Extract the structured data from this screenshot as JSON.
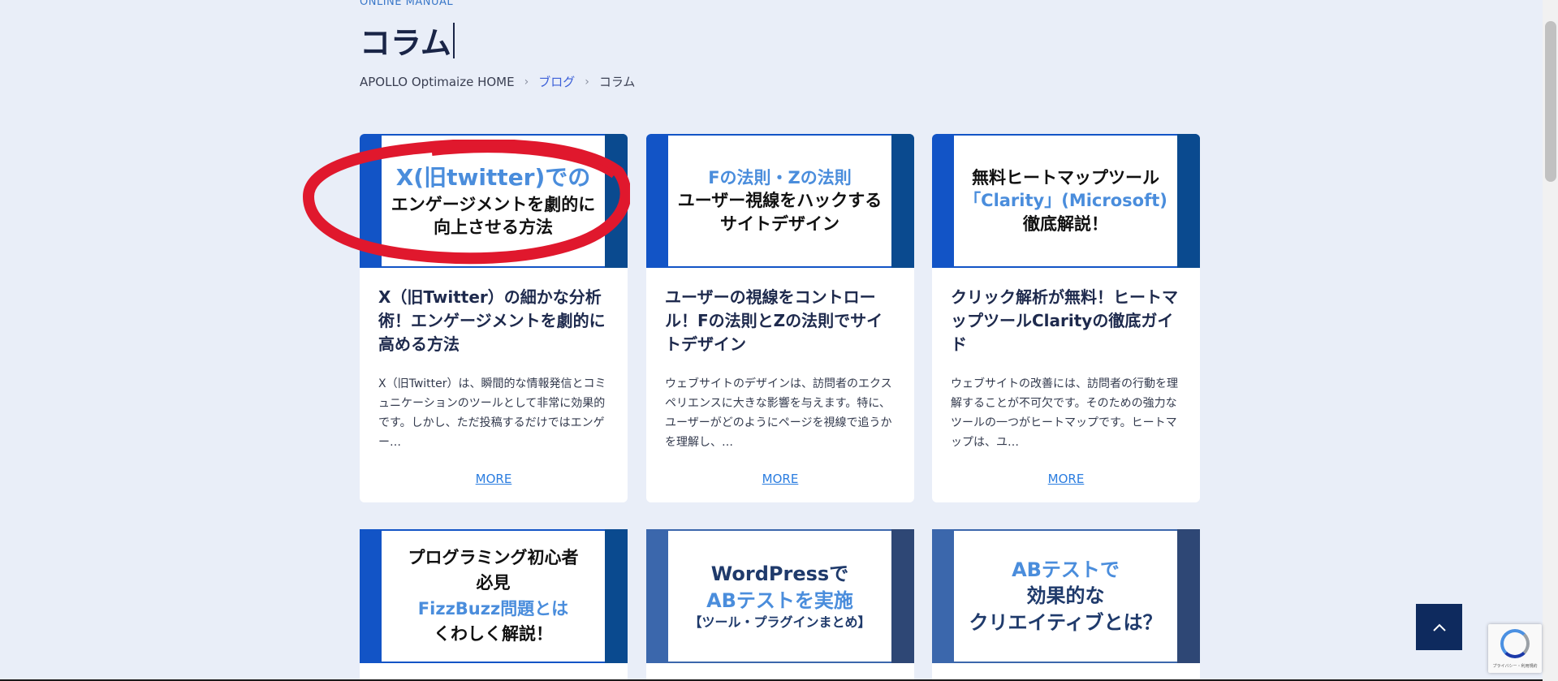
{
  "header": {
    "eyebrow": "ONLINE MANUAL",
    "title": "コラム"
  },
  "breadcrumb": {
    "home": "APOLLO Optimaize HOME",
    "blog": "ブログ",
    "current": "コラム",
    "separator": "›"
  },
  "cards": [
    {
      "thumb_lines": [
        "X(旧twitter)での",
        "エンゲージメントを劇的に",
        "向上させる方法"
      ],
      "title": "X（旧Twitter）の細かな分析術！エンゲージメントを劇的に高める方法",
      "excerpt": "X（旧Twitter）は、瞬間的な情報発信とコミュニケーションのツールとして非常に効果的です。しかし、ただ投稿するだけではエンゲー…",
      "more": "MORE"
    },
    {
      "thumb_lines": [
        "Fの法則・Zの法則",
        "ユーザー視線をハックする",
        "サイトデザイン"
      ],
      "title": "ユーザーの視線をコントロール！Fの法則とZの法則でサイトデザイン",
      "excerpt": "ウェブサイトのデザインは、訪問者のエクスペリエンスに大きな影響を与えます。特に、ユーザーがどのようにページを視線で追うかを理解し、…",
      "more": "MORE"
    },
    {
      "thumb_lines": [
        "無料ヒートマップツール",
        "「Clarity」(Microsoft)",
        "徹底解説！"
      ],
      "title": "クリック解析が無料！ヒートマップツールClarityの徹底ガイド",
      "excerpt": "ウェブサイトの改善には、訪問者の行動を理解することが不可欠です。そのための強力なツールの一つがヒートマップです。ヒートマップは、ユ…",
      "more": "MORE"
    },
    {
      "thumb_lines": [
        "プログラミング初心者",
        "必見",
        "FizzBuzz問題とは",
        "くわしく解説！"
      ]
    },
    {
      "thumb_lines": [
        "WordPressで",
        "ABテストを実施",
        "【ツール・プラグインまとめ】"
      ]
    },
    {
      "thumb_lines": [
        "ABテストで",
        "効果的な",
        "クリエイティブとは？"
      ]
    }
  ],
  "ui": {
    "to_top_icon": "chevron-up-icon",
    "recaptcha_text": "プライバシー・利用規約"
  },
  "colors": {
    "background": "#e9eef8",
    "accent": "#1254c6",
    "annotation": "#e0182d"
  }
}
